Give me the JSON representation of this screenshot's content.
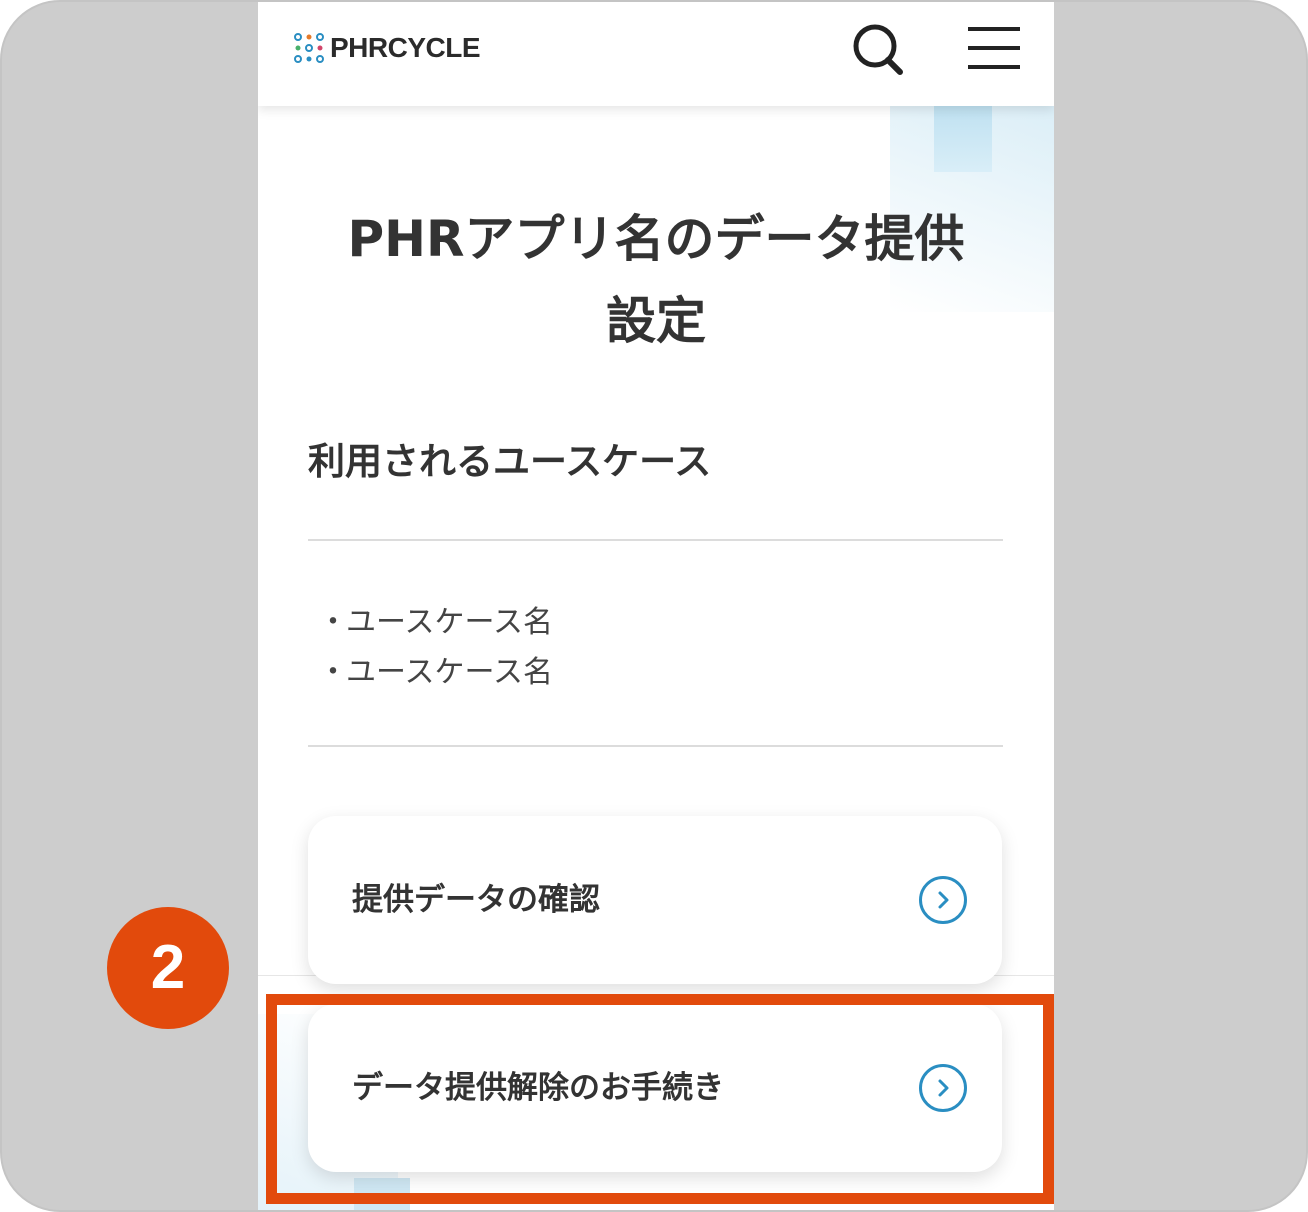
{
  "header": {
    "logo_text": "PHRCYCLE"
  },
  "main": {
    "page_title_line1": "PHRアプリ名のデータ提供",
    "page_title_line2": "設定",
    "section_title": "利用されるユースケース",
    "use_cases": [
      "ユースケース名",
      "ユースケース名"
    ],
    "cards": [
      {
        "label": "提供データの確認"
      },
      {
        "label": "データ提供解除のお手続き"
      }
    ]
  },
  "annotation": {
    "step_number": "2",
    "accent_color": "#e24a0c"
  },
  "colors": {
    "link_blue": "#2a8ec2",
    "text_dark": "#333333"
  }
}
